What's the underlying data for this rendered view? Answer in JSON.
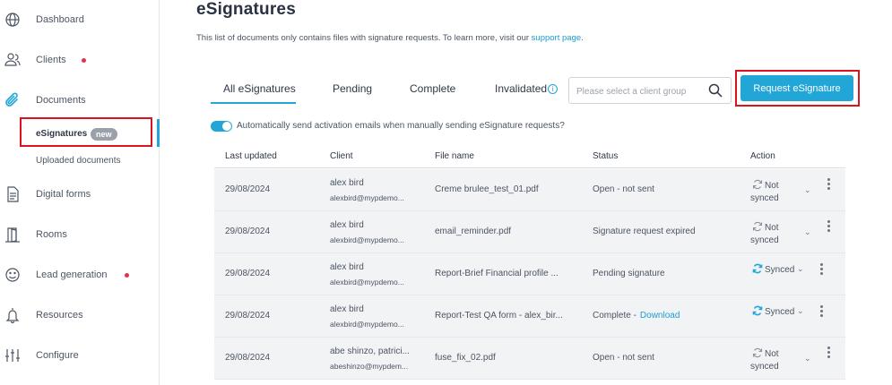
{
  "sidebar": {
    "items": [
      {
        "label": "Dashboard",
        "icon": "globe-icon"
      },
      {
        "label": "Clients",
        "icon": "users-icon",
        "dot": true
      },
      {
        "label": "Documents",
        "icon": "paperclip-icon"
      },
      {
        "label": "Digital forms",
        "icon": "form-icon"
      },
      {
        "label": "Rooms",
        "icon": "door-icon"
      },
      {
        "label": "Lead generation",
        "icon": "smiley-icon",
        "dot": true
      },
      {
        "label": "Resources",
        "icon": "bell-icon"
      },
      {
        "label": "Configure",
        "icon": "sliders-icon"
      }
    ],
    "sub_items": [
      {
        "label": "eSignatures",
        "badge": "new",
        "active": true
      },
      {
        "label": "Uploaded documents"
      }
    ]
  },
  "main": {
    "title": "eSignatures",
    "info_text": "This list of documents only contains files with signature requests. To learn more, visit our ",
    "info_link": "support page",
    "info_end": ".",
    "tabs": [
      {
        "label": "All eSignatures",
        "active": true
      },
      {
        "label": "Pending"
      },
      {
        "label": "Complete"
      },
      {
        "label": "Invalidated"
      }
    ],
    "search_placeholder": "Please select a client group",
    "request_button": "Request eSignature",
    "toggle_label": "Automatically send activation emails when manually sending eSignature requests?",
    "toggle_on": true
  },
  "table": {
    "headers": [
      "Last updated",
      "Client",
      "File name",
      "Status",
      "Action"
    ],
    "rows": [
      {
        "date": "29/08/2024",
        "client": "alex bird",
        "email": "alexbird@mypdemo...",
        "file": "Creme brulee_test_01.pdf",
        "status": "Open - not sent",
        "link": "",
        "sync_a": "Not",
        "sync_b": "synced",
        "synced": false
      },
      {
        "date": "29/08/2024",
        "client": "alex bird",
        "email": "alexbird@mypdemo...",
        "file": "email_reminder.pdf",
        "status": "Signature request expired",
        "link": "",
        "sync_a": "Not",
        "sync_b": "synced",
        "synced": false
      },
      {
        "date": "29/08/2024",
        "client": "alex bird",
        "email": "alexbird@mypdemo...",
        "file": "Report-Brief Financial profile ...",
        "status": "Pending signature",
        "link": "",
        "sync_a": "Synced",
        "sync_b": "",
        "synced": true
      },
      {
        "date": "29/08/2024",
        "client": "alex bird",
        "email": "alexbird@mypdemo...",
        "file": "Report-Test QA form - alex_bir...",
        "status": "Complete -",
        "link": "Download",
        "sync_a": "Synced",
        "sync_b": "",
        "synced": true
      },
      {
        "date": "29/08/2024",
        "client": "abe shinzo, patrici...",
        "email": "abeshinzo@mypdem...",
        "file": "fuse_fix_02.pdf",
        "status": "Open - not sent",
        "link": "",
        "sync_a": "Not",
        "sync_b": "synced",
        "synced": false
      }
    ]
  },
  "colors": {
    "accent": "#22a6d8",
    "highlight": "#d9141f",
    "dot": "#e0334d",
    "row_bg": "#f2f3f5"
  }
}
